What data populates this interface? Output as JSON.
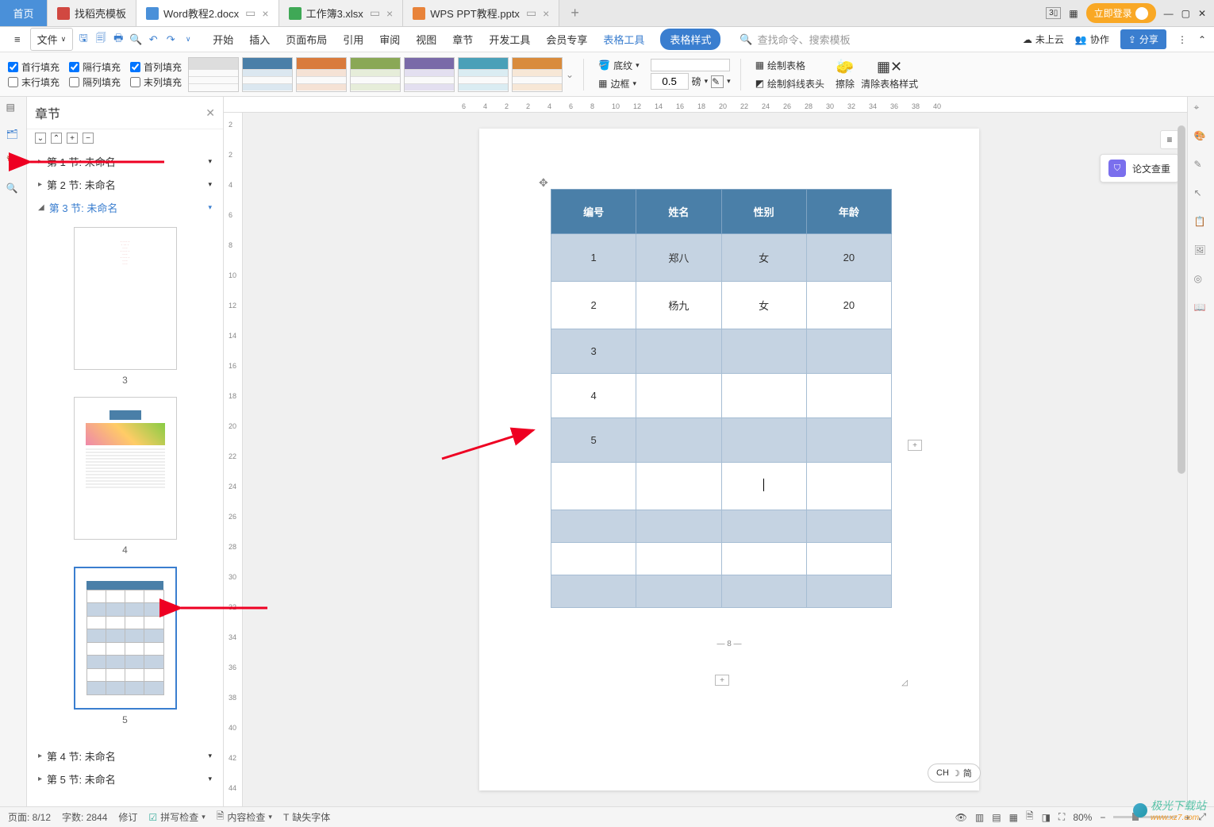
{
  "tabs": {
    "home": "首页",
    "items": [
      {
        "label": "找稻壳模板"
      },
      {
        "label": "Word教程2.docx",
        "active": true
      },
      {
        "label": "工作簿3.xlsx"
      },
      {
        "label": "WPS PPT教程.pptx"
      }
    ],
    "login": "立即登录"
  },
  "filerow": {
    "file": "文件",
    "menus": [
      "开始",
      "插入",
      "页面布局",
      "引用",
      "审阅",
      "视图",
      "章节",
      "开发工具",
      "会员专享"
    ],
    "table_tool": "表格工具",
    "table_style": "表格样式",
    "search_placeholder": "查找命令、搜索模板",
    "cloud": "未上云",
    "coop": "协作",
    "share": "分享"
  },
  "ribbon": {
    "fills": {
      "c1": "首行填充",
      "c2": "隔行填充",
      "c3": "首列填充",
      "c4": "末行填充",
      "c5": "隔列填充",
      "c6": "末列填充",
      "checked": {
        "c1": true,
        "c2": true,
        "c3": true,
        "c4": false,
        "c5": false,
        "c6": false
      }
    },
    "shading": "底纹",
    "border": "边框",
    "border_width": "0.5",
    "border_unit": "磅",
    "draw_table": "绘制表格",
    "draw_diag": "绘制斜线表头",
    "erase": "擦除",
    "clear_style": "清除表格样式"
  },
  "nav": {
    "title": "章节",
    "sections": [
      {
        "label": "第 1 节: 未命名"
      },
      {
        "label": "第 2 节: 未命名"
      },
      {
        "label": "第 3 节: 未命名",
        "active": true
      },
      {
        "label": "第 4 节: 未命名"
      },
      {
        "label": "第 5 节: 未命名"
      }
    ],
    "thumbs": [
      "3",
      "4",
      "5"
    ]
  },
  "table": {
    "headers": [
      "编号",
      "姓名",
      "性别",
      "年龄"
    ],
    "rows": [
      {
        "odd": true,
        "cells": [
          "1",
          "郑八",
          "女",
          "20"
        ]
      },
      {
        "odd": false,
        "cells": [
          "2",
          "杨九",
          "女",
          "20"
        ]
      },
      {
        "odd": true,
        "cells": [
          "3",
          "",
          "",
          ""
        ]
      },
      {
        "odd": false,
        "cells": [
          "4",
          "",
          "",
          ""
        ]
      },
      {
        "odd": true,
        "cells": [
          "5",
          "",
          "",
          ""
        ]
      },
      {
        "odd": false,
        "cells": [
          "",
          "",
          "",
          ""
        ]
      },
      {
        "odd": true,
        "cells": [
          "",
          "",
          "",
          ""
        ]
      },
      {
        "odd": false,
        "cells": [
          "",
          "",
          "",
          ""
        ]
      },
      {
        "odd": true,
        "cells": [
          "",
          "",
          "",
          ""
        ]
      }
    ],
    "page_num": "— 8 —"
  },
  "float": {
    "paper_check": "论文查重"
  },
  "status": {
    "page": "页面: 8/12",
    "words": "字数: 2844",
    "track": "修订",
    "spell": "拼写检查",
    "content": "内容检查",
    "font": "缺失字体",
    "zoom": "80%",
    "ime": "CH ",
    "ime2": "简"
  },
  "hruler_nums": [
    "6",
    "4",
    "2",
    "2",
    "4",
    "6",
    "8",
    "10",
    "12",
    "14",
    "16",
    "18",
    "20",
    "22",
    "24",
    "26",
    "28",
    "30",
    "32",
    "34",
    "36",
    "38",
    "40"
  ],
  "vruler_nums": [
    "2",
    "2",
    "4",
    "6",
    "8",
    "10",
    "12",
    "14",
    "16",
    "18",
    "20",
    "22",
    "24",
    "26",
    "28",
    "30",
    "32",
    "34",
    "36",
    "38",
    "40",
    "42",
    "44"
  ],
  "watermark": {
    "name": "极光下载站",
    "url": "www.xz7.com"
  }
}
